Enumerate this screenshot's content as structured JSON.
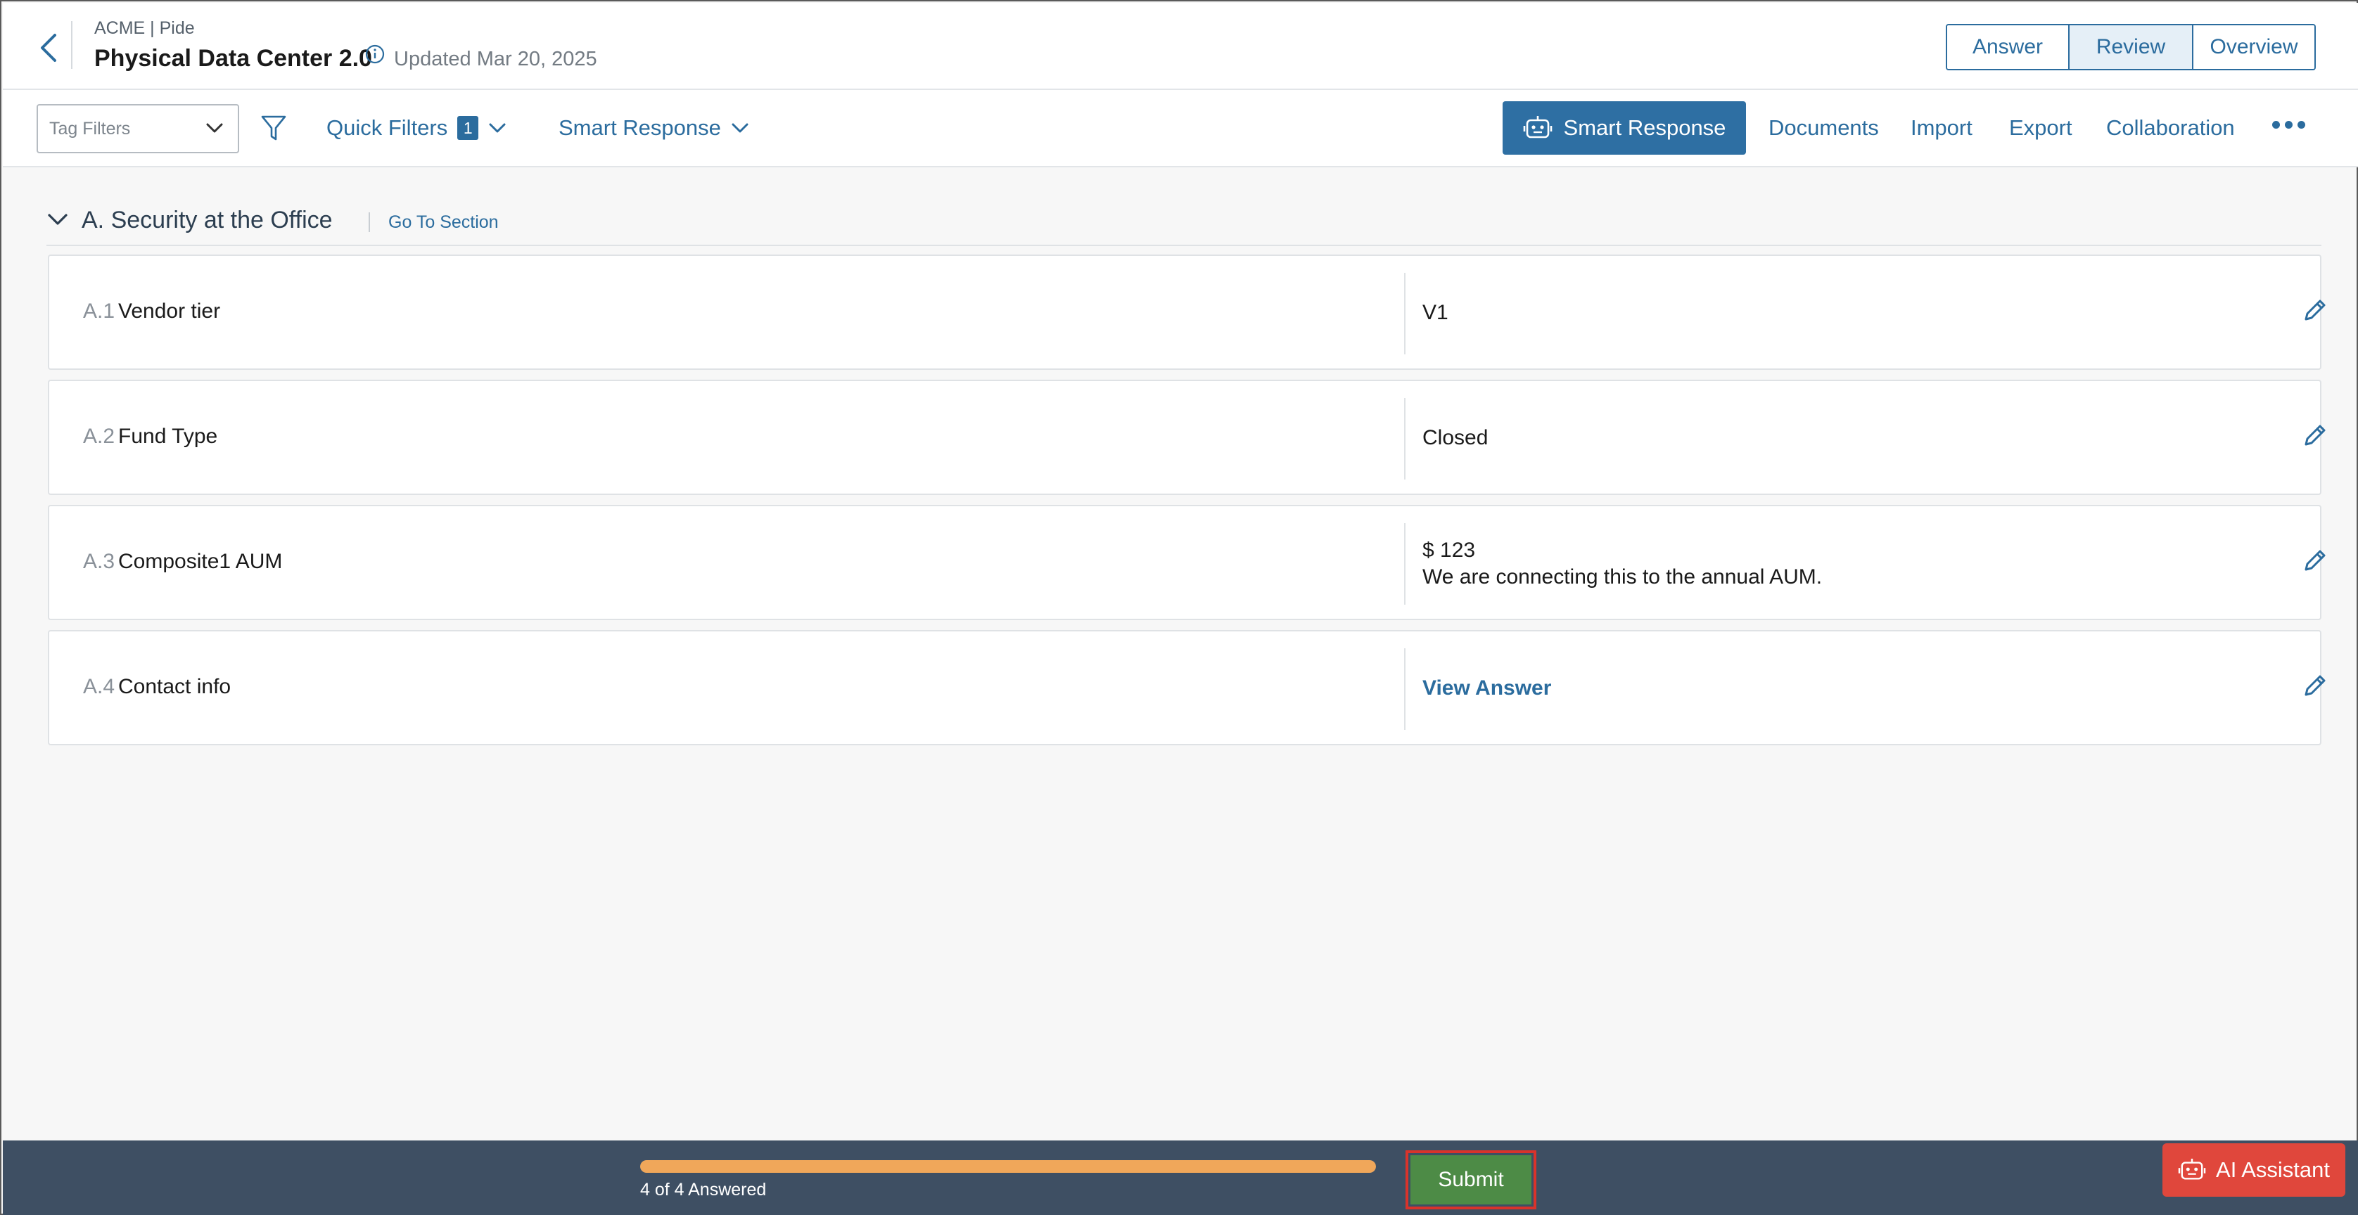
{
  "header": {
    "breadcrumb": "ACME | Pide",
    "title": "Physical Data Center 2.0",
    "updated": "Updated Mar 20, 2025",
    "view_tabs": [
      {
        "label": "Answer",
        "active": false
      },
      {
        "label": "Review",
        "active": true
      },
      {
        "label": "Overview",
        "active": false
      }
    ]
  },
  "toolbar": {
    "tag_filters_placeholder": "Tag Filters",
    "quick_filters_label": "Quick Filters",
    "quick_filters_count": "1",
    "smart_response_dropdown": "Smart Response",
    "smart_response_button": "Smart Response",
    "documents": "Documents",
    "import": "Import",
    "export": "Export",
    "collaboration": "Collaboration"
  },
  "section": {
    "title": "A. Security at the Office",
    "goto_label": "Go To Section",
    "questions": [
      {
        "number": "A.1",
        "text": "Vendor tier",
        "answer_lines": [
          "V1"
        ]
      },
      {
        "number": "A.2",
        "text": "Fund Type",
        "answer_lines": [
          "Closed"
        ]
      },
      {
        "number": "A.3",
        "text": "Composite1 AUM",
        "answer_lines": [
          "$ 123",
          "We are connecting this to the annual AUM."
        ]
      },
      {
        "number": "A.4",
        "text": "Contact info",
        "answer_link": "View Answer"
      }
    ]
  },
  "footer": {
    "progress_text": "4 of 4 Answered",
    "answered": 4,
    "total": 4,
    "submit_label": "Submit",
    "ai_assistant_label": "AI Assistant"
  },
  "colors": {
    "accent": "#2b6c9e",
    "progress": "#f0a75a",
    "submit": "#4d8b46",
    "ai_assistant": "#e0473c",
    "footer_bg": "#3e4f63"
  }
}
